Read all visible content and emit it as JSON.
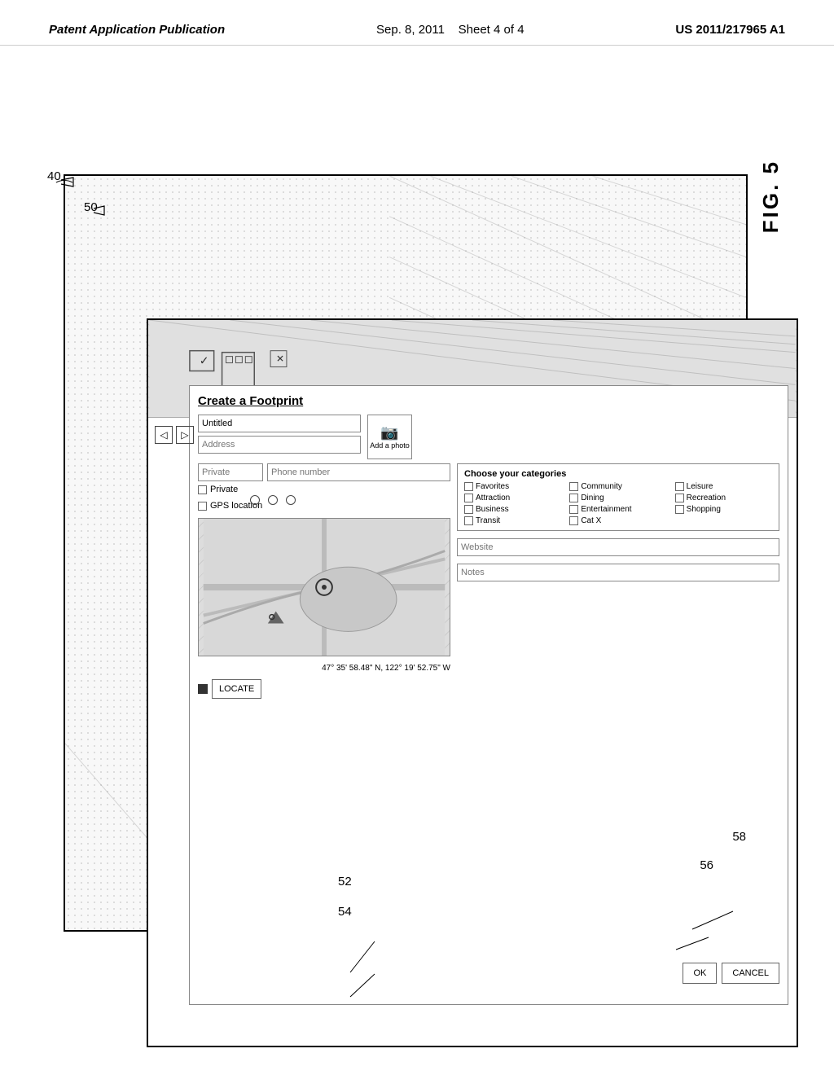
{
  "header": {
    "left": "Patent Application Publication",
    "center_date": "Sep. 8, 2011",
    "center_sheet": "Sheet 4 of 4",
    "right": "US 2011/217965 A1"
  },
  "fig": {
    "number": "FIG. 5",
    "label": "FIG. 5"
  },
  "refs": {
    "r40": "40",
    "r50": "50",
    "r52": "52",
    "r54": "54",
    "r56": "56",
    "r58": "58"
  },
  "form": {
    "title": "Create a Footprint",
    "name_placeholder": "Untitled",
    "address_placeholder": "Address",
    "photo_label": "Add a photo",
    "phone_placeholder": "Phone number",
    "website_label": "Website",
    "notes_label": "Notes",
    "private_label": "Private",
    "gps_label": "GPS location",
    "categories_title": "Choose your categories",
    "categories": [
      {
        "label": "Favorites"
      },
      {
        "label": "Community"
      },
      {
        "label": "Leisure"
      },
      {
        "label": "Transit"
      },
      {
        "label": "Attraction"
      },
      {
        "label": "Dining"
      },
      {
        "label": "Recreation"
      },
      {
        "label": "Cat X"
      },
      {
        "label": "Business"
      },
      {
        "label": "Entertainment"
      },
      {
        "label": "Shopping"
      }
    ],
    "coordinates": "47° 35' 58.48\" N, 122° 19' 52.75\" W",
    "locate_btn": "LOCATE",
    "ok_btn": "OK",
    "cancel_btn": "CANCEL"
  }
}
